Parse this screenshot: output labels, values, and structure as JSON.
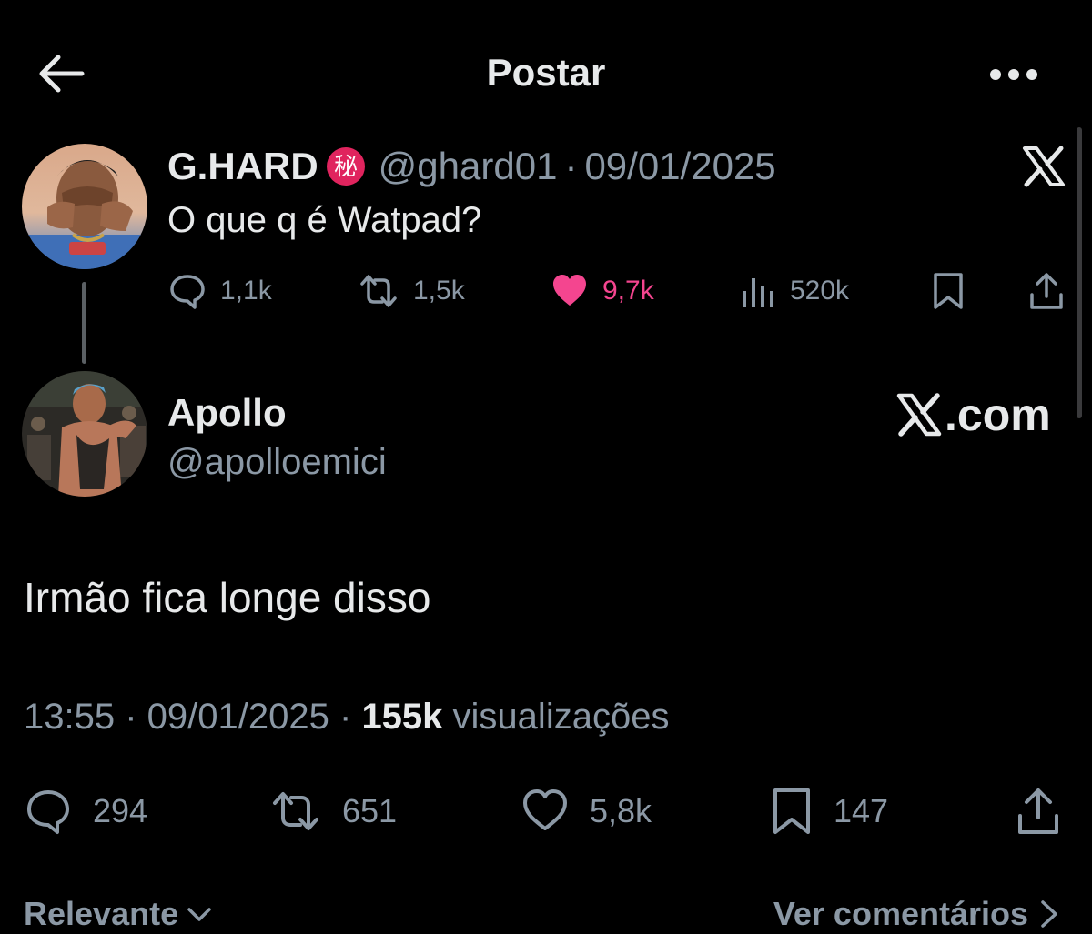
{
  "header": {
    "title": "Postar",
    "back_icon": "arrow-left-icon",
    "more_icon": "more-horizontal-icon"
  },
  "quoted_tweet": {
    "author_name": "G.HARD",
    "badge_char": "秘",
    "handle": "@ghard01",
    "date": "09/01/2025",
    "text": "O que q é Watpad?",
    "replies": "1,1k",
    "reposts": "1,5k",
    "likes": "9,7k",
    "views": "520k",
    "liked": true
  },
  "tweet": {
    "author_name": "Apollo",
    "handle": "@apolloemici",
    "source_badge": ".com",
    "text": "Irmão fica longe disso",
    "time": "13:55",
    "date": "09/01/2025",
    "views_count": "155k",
    "views_label": "visualizações",
    "replies": "294",
    "reposts": "651",
    "likes": "5,8k",
    "bookmarks": "147"
  },
  "footer": {
    "sort_label": "Relevante",
    "view_comments_label": "Ver comentários"
  },
  "colors": {
    "background": "#000000",
    "text": "#e7e9ea",
    "secondary": "#8b98a5",
    "like": "#f4458f",
    "badge": "#e0245e"
  }
}
